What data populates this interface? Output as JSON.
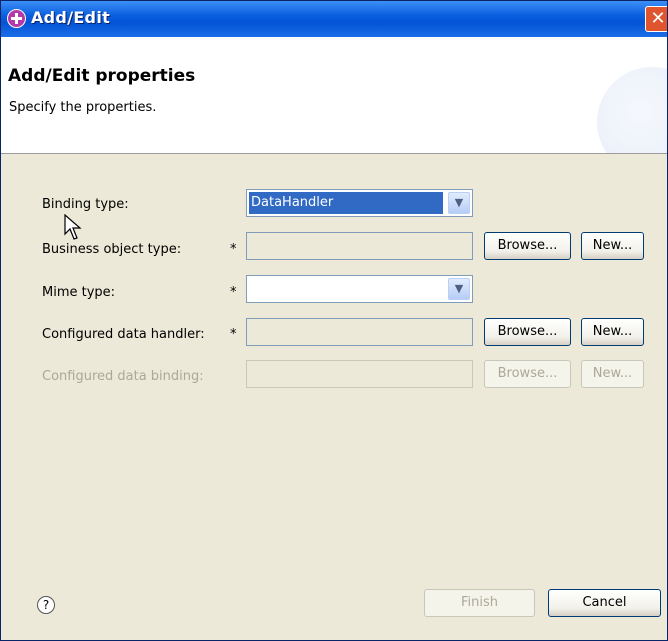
{
  "window": {
    "title": "Add/Edit",
    "close_glyph": "✕"
  },
  "header": {
    "title": "Add/Edit properties",
    "description": "Specify the properties."
  },
  "form": {
    "binding_type": {
      "label": "Binding type:",
      "value": "DataHandler"
    },
    "business_object_type": {
      "label": "Business object type:",
      "required": "*",
      "value": "",
      "browse": "Browse...",
      "new": "New..."
    },
    "mime_type": {
      "label": "Mime type:",
      "required": "*",
      "value": ""
    },
    "configured_data_handler": {
      "label": "Configured data handler:",
      "required": "*",
      "value": "",
      "browse": "Browse...",
      "new": "New..."
    },
    "configured_data_binding": {
      "label": "Configured data binding:",
      "value": "",
      "browse": "Browse...",
      "new": "New..."
    }
  },
  "footer": {
    "help_glyph": "?",
    "finish": "Finish",
    "cancel": "Cancel"
  },
  "icons": {
    "dropdown": "chevron-down-icon",
    "help": "help-icon",
    "app": "app-icon"
  }
}
